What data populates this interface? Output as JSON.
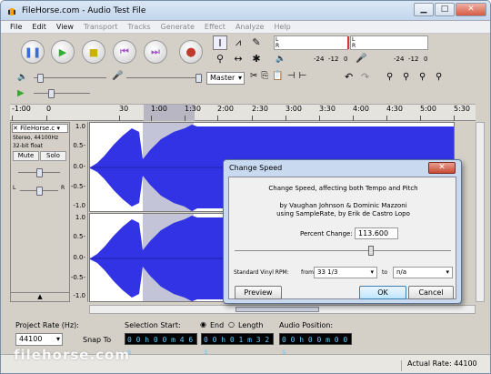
{
  "window": {
    "title": "FileHorse.com - Audio Test File",
    "min": "▁",
    "max": "□",
    "close": "✕"
  },
  "menu": [
    "File",
    "Edit",
    "View",
    "Transport",
    "Tracks",
    "Generate",
    "Effect",
    "Analyze",
    "Help"
  ],
  "meters": {
    "L": "L",
    "R": "R",
    "ticks": [
      "-24",
      "-12",
      "0"
    ]
  },
  "device": {
    "host": "Master"
  },
  "ruler": [
    "-1:00",
    "0",
    "30",
    "1:00",
    "1:30",
    "2:00",
    "2:30",
    "3:00",
    "3:30",
    "4:00",
    "4:30",
    "5:00",
    "5:30"
  ],
  "track": {
    "name": "FileHorse.c",
    "info1": "Stereo, 44100Hz",
    "info2": "32-bit float",
    "mute": "Mute",
    "solo": "Solo",
    "L": "L",
    "R": "R"
  },
  "scale": [
    "1.0",
    "0.5-",
    "0.0-",
    "-0.5-",
    "-1.0",
    "1.0",
    "0.5-",
    "0.0-",
    "-0.5-",
    "-1.0"
  ],
  "bottom": {
    "project_rate_label": "Project Rate (Hz):",
    "project_rate": "44100",
    "snap_to": "Snap To",
    "selection_start_label": "Selection Start:",
    "end_label": "End",
    "length_label": "Length",
    "audio_position_label": "Audio Position:",
    "sel_start": "0 0 h 0 0 m 4 6 s",
    "sel_end": "0 0 h 0 1 m 3 2 s",
    "audio_pos": "0 0 h 0 0 m 0 0 s"
  },
  "status": {
    "actual_rate": "Actual Rate: 44100"
  },
  "dialog": {
    "title": "Change Speed",
    "close": "✕",
    "desc": "Change Speed, affecting both Tempo and Pitch",
    "credit1": "by Vaughan Johnson & Dominic Mazzoni",
    "credit2": "using SampleRate, by Erik de Castro Lopo",
    "percent_label": "Percent Change:",
    "percent_value": "113.600",
    "percent_slider": 0.63,
    "vinyl_label": "Standard Vinyl RPM:",
    "from_label": "from",
    "from_value": "33 1/3",
    "to_label": "to",
    "to_value": "n/a",
    "preview": "Preview",
    "ok": "OK",
    "cancel": "Cancel"
  },
  "watermark": "filehorse.com",
  "colors": {
    "wave": "#3333e6",
    "wave_selected": "#4a4af0",
    "selection_bg": "#c4c4d8",
    "record": "#c0392b",
    "play": "#2fae2f"
  }
}
